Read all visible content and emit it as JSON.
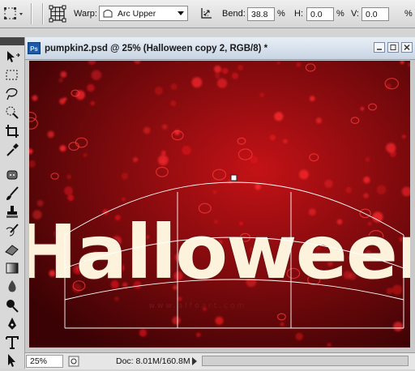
{
  "options_bar": {
    "warp_label": "Warp:",
    "warp_style": "Arc Upper",
    "bend_label": "Bend:",
    "bend_value": "38.8",
    "bend_unit": "%",
    "h_label": "H:",
    "h_value": "0.0",
    "h_unit": "%",
    "v_label": "V:",
    "v_value": "0.0",
    "v_unit": "%"
  },
  "document": {
    "badge": "Ps",
    "title": "pumpkin2.psd @ 25% (Halloween copy 2, RGB/8) *",
    "canvas_text": "Halloween",
    "watermark": "www.alfoart.com"
  },
  "status": {
    "zoom": "25%",
    "doc_info": "Doc: 8.01M/160.8M"
  },
  "icons": [
    "transform-grid-icon",
    "warp-icon",
    "arc-upper-icon",
    "orientation-icon",
    "ps-badge-icon",
    "move-tool-icon",
    "marquee-tool-icon",
    "lasso-tool-icon",
    "quick-select-tool-icon",
    "crop-tool-icon",
    "eyedropper-tool-icon",
    "spot-heal-tool-icon",
    "brush-tool-icon",
    "clone-stamp-tool-icon",
    "history-brush-tool-icon",
    "eraser-tool-icon",
    "gradient-tool-icon",
    "blur-tool-icon",
    "dodge-tool-icon",
    "pen-tool-icon",
    "type-tool-icon",
    "path-select-tool-icon"
  ],
  "colors": {
    "canvas_center": "#c41216",
    "canvas_edge": "#3a0204",
    "text_fill": "#fdf2dc",
    "text_outline": "#6b0f10"
  }
}
